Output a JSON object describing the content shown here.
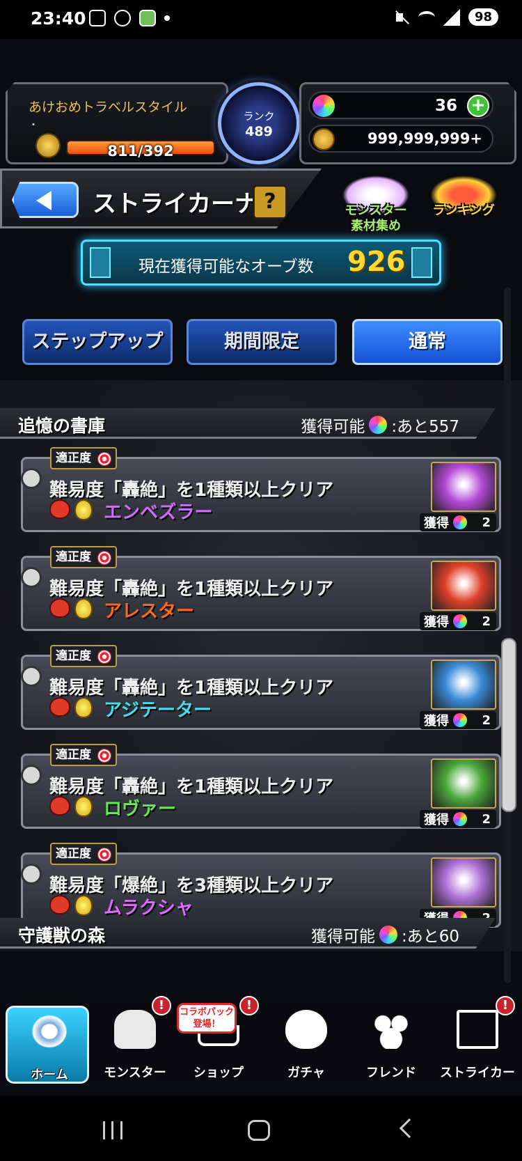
{
  "status_bar": {
    "time": "23:40",
    "battery": "98"
  },
  "header": {
    "player_name": "あけおめトラベルスタイル",
    "player_sub": "・",
    "stamina": "811/392",
    "rank_label": "ランク",
    "rank_value": "489",
    "orbs": "36",
    "gold": "999,999,999+"
  },
  "title_bar": {
    "title": "ストライカーナビ",
    "help": "?"
  },
  "side_buttons": {
    "monster_collect": "モンスター\n素材集め",
    "ranking": "ランキング"
  },
  "orbs_banner": {
    "label": "現在獲得可能なオーブ数",
    "count": "926"
  },
  "tabs": [
    {
      "label": "ステップアップ",
      "active": false
    },
    {
      "label": "期間限定",
      "active": false
    },
    {
      "label": "通常",
      "active": true
    }
  ],
  "sections": [
    {
      "title": "追憶の書庫",
      "available_label": "獲得可能",
      "available_rest": ":あと557"
    },
    {
      "title": "守護獣の森",
      "available_label": "獲得可能",
      "available_rest": ":あと60"
    }
  ],
  "missions": [
    {
      "tag": "適正度",
      "text": "難易度「轟絶」を1種類以上クリア",
      "monster": "エンベズラー",
      "monster_color": "#d26bff",
      "reward_label": "獲得",
      "reward_count": "2",
      "thumb_color": "#b54ad8"
    },
    {
      "tag": "適正度",
      "text": "難易度「轟絶」を1種類以上クリア",
      "monster": "アレスター",
      "monster_color": "#ff6a1a",
      "reward_label": "獲得",
      "reward_count": "2",
      "thumb_color": "#e0402a"
    },
    {
      "tag": "適正度",
      "text": "難易度「轟絶」を1種類以上クリア",
      "monster": "アジテーター",
      "monster_color": "#3fe0f0",
      "reward_label": "獲得",
      "reward_count": "2",
      "thumb_color": "#3a8ad8"
    },
    {
      "tag": "適正度",
      "text": "難易度「轟絶」を1種類以上クリア",
      "monster": "ロヴァー",
      "monster_color": "#5ef04a",
      "reward_label": "獲得",
      "reward_count": "2",
      "thumb_color": "#4aa83a"
    },
    {
      "tag": "適正度",
      "text": "難易度「爆絶」を3種類以上クリア",
      "monster": "ムラクシャ",
      "monster_color": "#e06aff",
      "reward_label": "獲得",
      "reward_count": "2",
      "thumb_color": "#b070d8"
    }
  ],
  "bottom_nav": {
    "home": "ホーム",
    "monster": "モンスター",
    "shop": "ショップ",
    "gacha": "ガチャ",
    "friend": "フレンド",
    "striker": "ストライカー",
    "collab_bubble": "コラボパック\n登場！",
    "alert": "!"
  }
}
